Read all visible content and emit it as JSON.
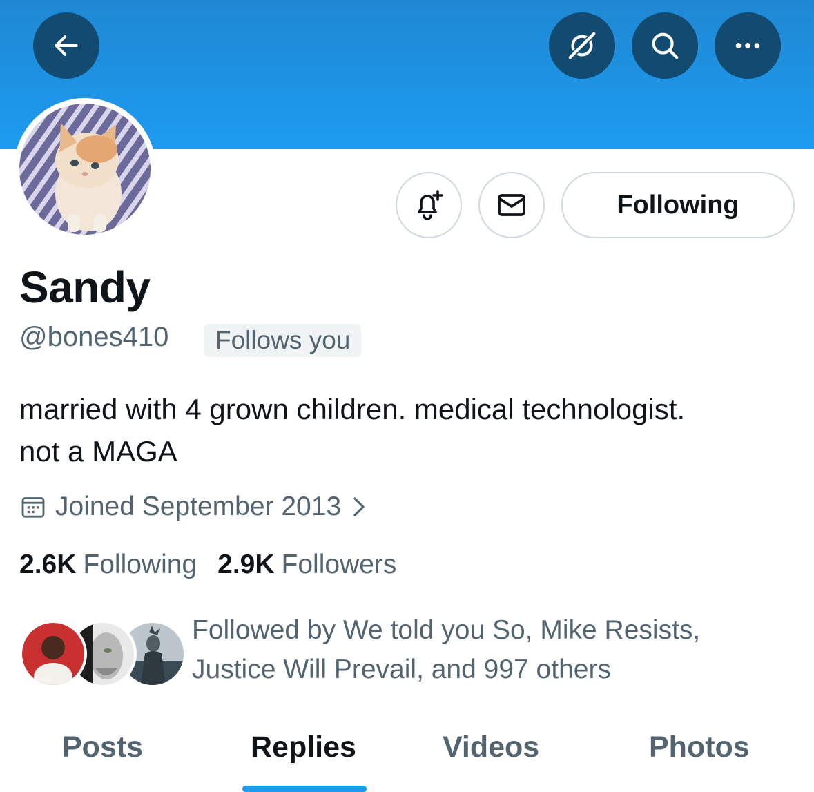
{
  "header": {
    "icons": [
      "back-arrow-icon",
      "grok-icon",
      "search-icon",
      "more-icon"
    ],
    "banner_color": "#1d9bf0",
    "button_color": "#124a70"
  },
  "profile": {
    "display_name": "Sandy",
    "handle": "@bones410",
    "follows_you_label": "Follows you",
    "bio_line1": "married with 4 grown children. medical technologist.",
    "bio_line2": "not a MAGA",
    "joined": "Joined September 2013",
    "avatar_icon": "kitten-avatar"
  },
  "actions": {
    "notify_icon": "bell-plus-icon",
    "message_icon": "envelope-icon",
    "following_label": "Following"
  },
  "stats": {
    "following_count": "2.6K",
    "following_label": "Following",
    "followers_count": "2.9K",
    "followers_label": "Followers"
  },
  "followed_by": {
    "line1": "Followed by We told you So, Mike Resists,",
    "line2": "Justice Will Prevail, and 997 others"
  },
  "tabs": [
    {
      "label": "Posts",
      "active": false
    },
    {
      "label": "Replies",
      "active": true
    },
    {
      "label": "Videos",
      "active": false
    },
    {
      "label": "Photos",
      "active": false
    }
  ],
  "accent_color": "#1d9bf0"
}
